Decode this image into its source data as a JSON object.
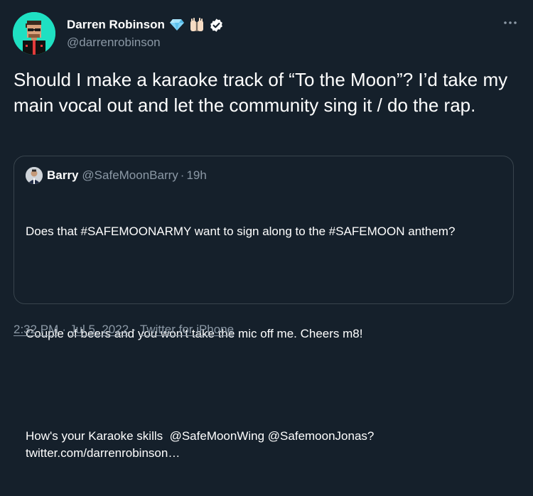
{
  "tweet": {
    "author": {
      "display_name": "Darren Robinson",
      "handle": "@darrenrobinson",
      "badges": [
        "gem-stone-icon",
        "raised-hands-icon",
        "verified-badge-icon"
      ]
    },
    "text": "Should I make a karaoke track of “To the Moon”? I’d take my main vocal out and let the community sing it / do the rap.",
    "quoted": {
      "display_name": "Barry",
      "handle": "@SafeMoonBarry",
      "separator": "·",
      "time": "19h",
      "paragraphs": [
        "Does that #SAFEMOONARMY want to sign along to the #SAFEMOON anthem?",
        "Couple of beers and you won't take the mic off me. Cheers m8!",
        "How's your Karaoke skills  @SafeMoonWing @SafemoonJonas? twitter.com/darrenrobinson…"
      ]
    },
    "meta": {
      "time": "2:32 PM",
      "separator": "·",
      "date": "Jul 5, 2022",
      "source": "Twitter for iPhone"
    }
  },
  "colors": {
    "background": "#15202b",
    "secondary_text": "#8b98a5",
    "border": "#38444d",
    "avatar_bg": "#1fe0c2",
    "verified": "#ffffff"
  },
  "icons": {
    "more": "more-dots-icon"
  }
}
